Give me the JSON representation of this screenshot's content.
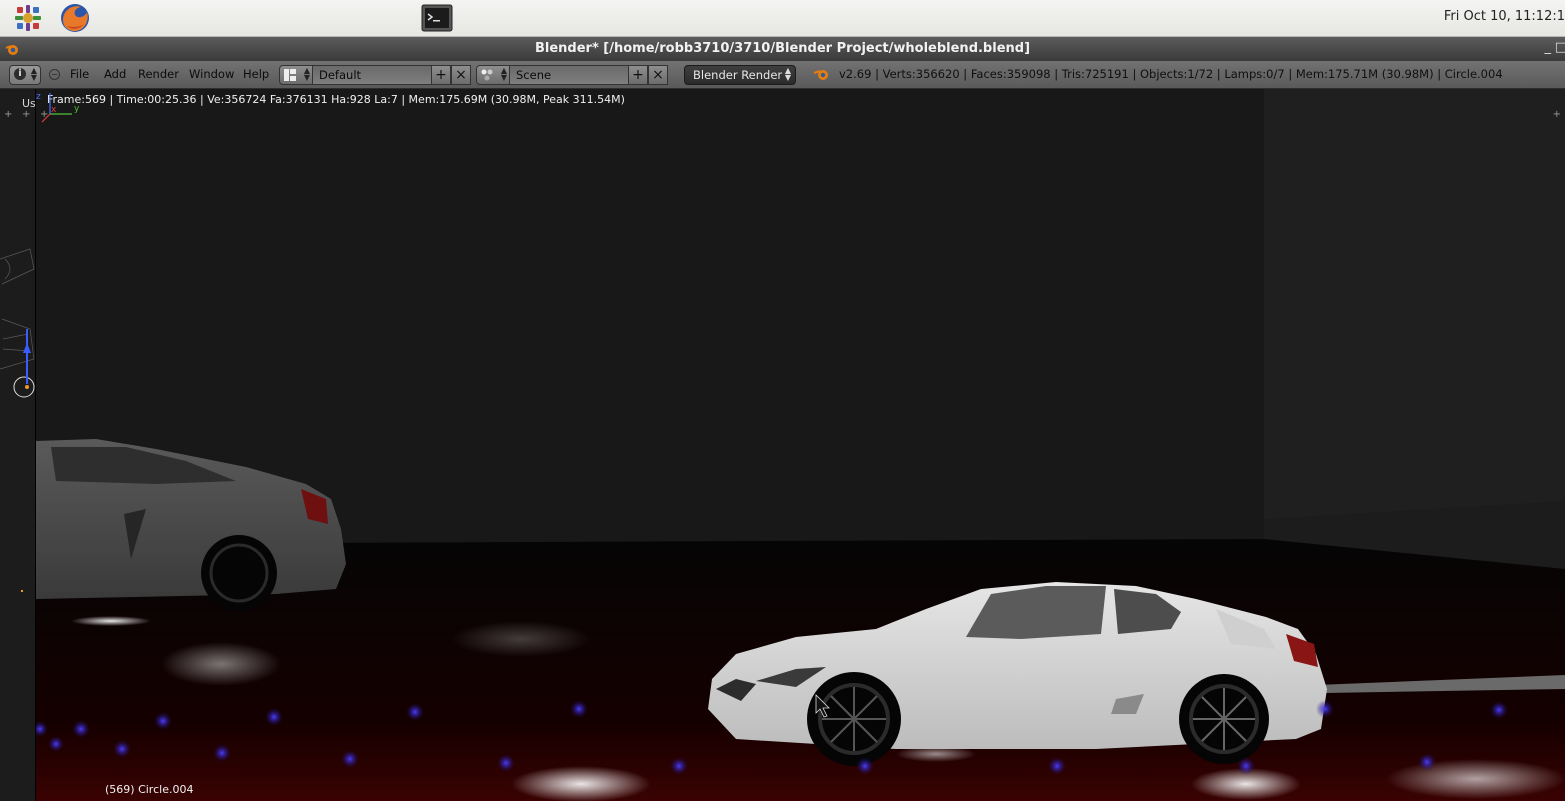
{
  "os_panel": {
    "clock": "Fri Oct 10, 11:12:1",
    "launchers": [
      "applications-icon",
      "firefox-icon",
      "terminal-icon"
    ]
  },
  "window": {
    "title": "Blender* [/home/robb3710/3710/Blender Project/wholeblend.blend]",
    "minimize": "_",
    "maximize": "□"
  },
  "info_header": {
    "menus": [
      "File",
      "Add",
      "Render",
      "Window",
      "Help"
    ],
    "layout": "Default",
    "scene": "Scene",
    "render_engine": "Blender Render",
    "stats": "v2.69 | Verts:356620 | Faces:359098 | Tris:725191 | Objects:1/72 | Lamps:0/7 | Mem:175.71M (30.98M) | Circle.004"
  },
  "left_strip": {
    "label": "Us"
  },
  "viewport": {
    "render_info": "Frame:569 | Time:00:25.36 | Ve:356724 Fa:376131 Ha:928 La:7 | Mem:175.69M (30.98M, Peak 311.54M)",
    "object_label": "(569) Circle.004",
    "axis_x": "x",
    "axis_y": "y",
    "axis_z": "z"
  },
  "colors": {
    "header_bg": "#656565",
    "title_bg": "#484848",
    "viewport_bg": "#1a1a1a",
    "ground_light": "#3a0000",
    "led_blue": "#3a33ff"
  }
}
